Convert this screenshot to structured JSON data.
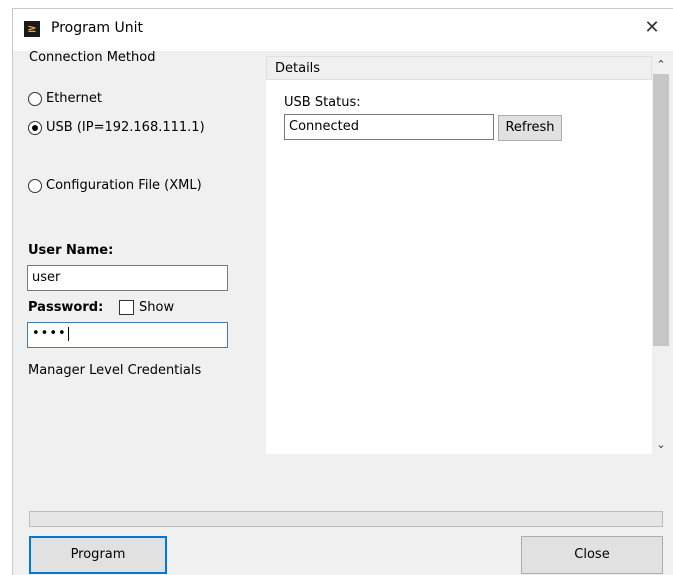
{
  "window": {
    "title": "Program Unit",
    "close_glyph": "✕",
    "app_icon": "program-unit-icon"
  },
  "connection": {
    "label": "Connection Method",
    "options": [
      {
        "label": "Ethernet",
        "checked": false
      },
      {
        "label": "USB (IP=192.168.111.1)",
        "checked": true
      },
      {
        "label": "Configuration File (XML)",
        "checked": false
      }
    ]
  },
  "credentials": {
    "user_label": "User Name:",
    "user_value": "user",
    "password_label": "Password:",
    "password_value": "••••",
    "show_label": "Show",
    "show_checked": false,
    "note": "Manager Level Credentials"
  },
  "details": {
    "title": "Details",
    "usb_status_label": "USB Status:",
    "usb_status_value": "Connected",
    "refresh_label": "Refresh"
  },
  "scrollbar": {
    "up_glyph": "⌃",
    "down_glyph": "⌄"
  },
  "progress": {
    "value": 0
  },
  "buttons": {
    "program_label": "Program",
    "close_label": "Close"
  },
  "colors": {
    "accent": "#0078d7",
    "window_bg": "#f0f0f0"
  }
}
